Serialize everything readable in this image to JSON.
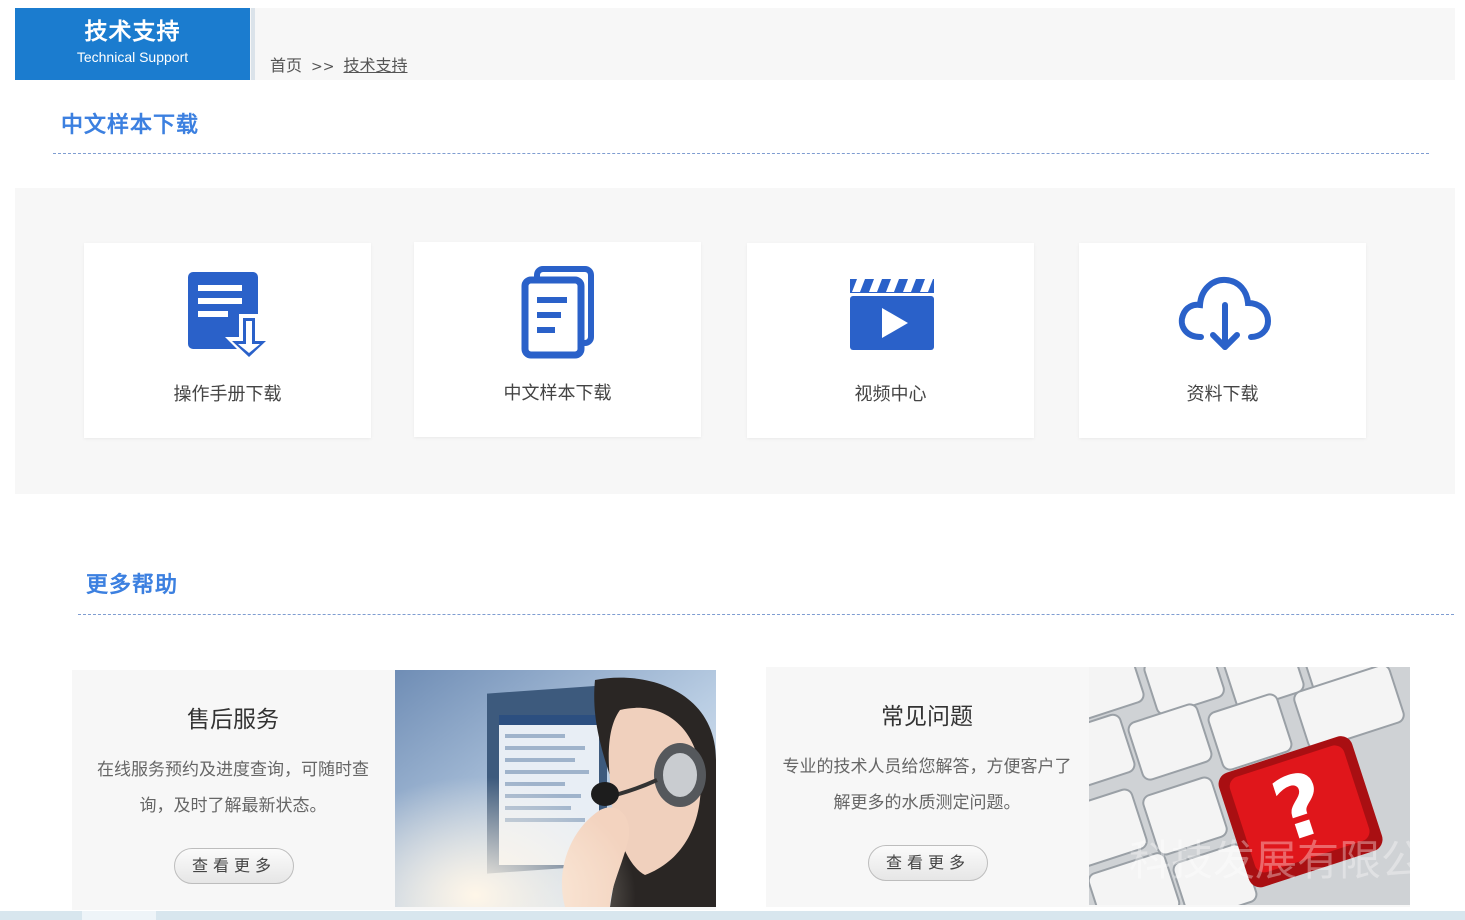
{
  "header": {
    "section_title_cn": "技术支持",
    "section_title_en": "Technical Support",
    "breadcrumb": {
      "home": "首页",
      "separator": ">>",
      "current": "技术支持"
    }
  },
  "downloads": {
    "title": "中文样本下载",
    "items": [
      {
        "label": "操作手册下载",
        "icon": "manual-download-icon"
      },
      {
        "label": "中文样本下载",
        "icon": "documents-icon"
      },
      {
        "label": "视频中心",
        "icon": "video-clapper-icon"
      },
      {
        "label": "资料下载",
        "icon": "cloud-download-icon"
      }
    ]
  },
  "help": {
    "title": "更多帮助",
    "cards": [
      {
        "title": "售后服务",
        "description": "在线服务预约及进度查询，可随时查询，及时了解最新状态。",
        "more": "查看更多",
        "image": "customer-service-photo"
      },
      {
        "title": "常见问题",
        "description": "专业的技术人员给您解答，方便客户了解更多的水质测定问题。",
        "more": "查看更多",
        "image": "keyboard-question-photo",
        "watermark": "科技发展有限公司"
      }
    ]
  },
  "colors": {
    "brand_blue": "#1b7ccf",
    "title_blue": "#3c80e0",
    "icon_blue": "#2a61c9",
    "panel_gray": "#f7f7f7"
  }
}
